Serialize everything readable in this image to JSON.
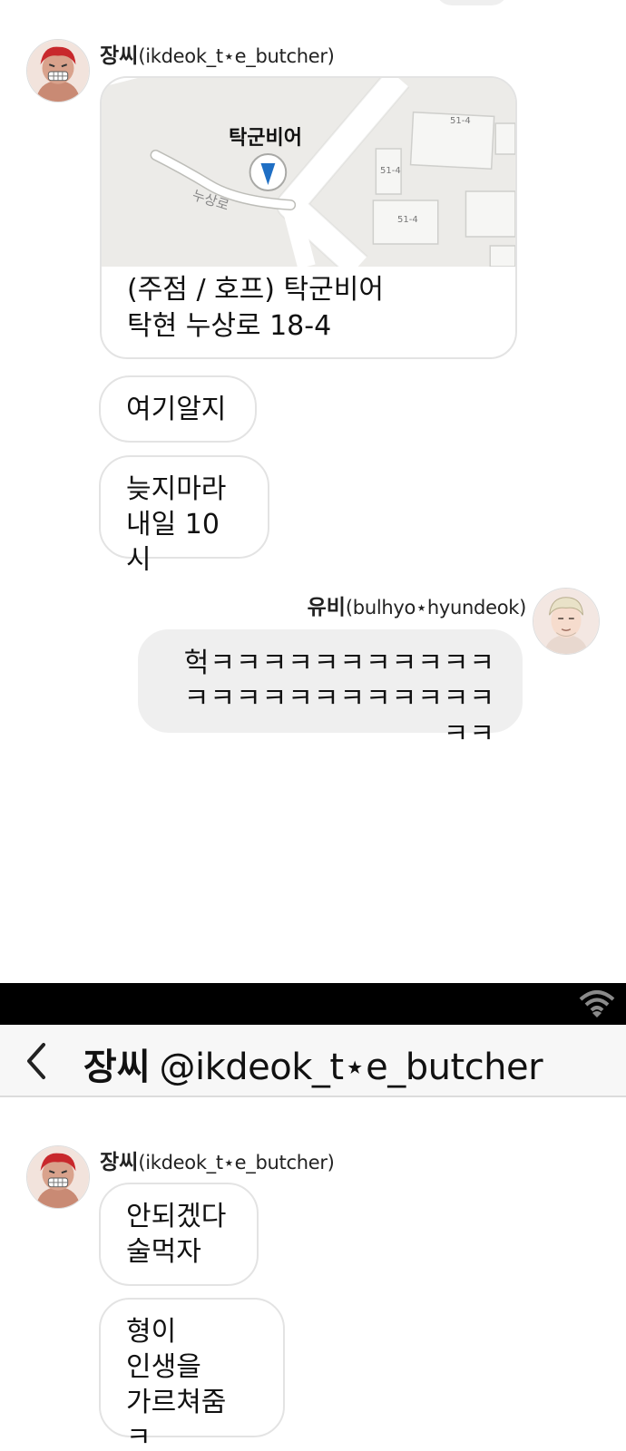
{
  "chat": {
    "contact_name": "장씨",
    "contact_handle_paren": "(ikdeok_t⋆e_butcher)",
    "me_name": "유비",
    "me_handle_paren": "(bulhyo⋆hyundeok)"
  },
  "map_card": {
    "place_label": "탁군비어",
    "street_label": "누상로",
    "lot_labels": [
      "51-4",
      "51-4",
      "51-4"
    ],
    "title": "(주점 / 호프) 탁군비어",
    "address": "탁현 누상로 18-4"
  },
  "messages_top": [
    {
      "text": "여기알지"
    },
    {
      "text": "늦지마라\n내일 10시"
    }
  ],
  "my_message": {
    "text": "헉ㅋㅋㅋㅋㅋㅋㅋㅋㅋㅋㅋ\nㅋㅋㅋㅋㅋㅋㅋㅋㅋㅋㅋㅋㅋㅋ"
  },
  "nav": {
    "title_name": "장씨",
    "title_handle": "@ikdeok_t⋆e_butcher"
  },
  "messages_bottom": [
    {
      "text": "안되겠다\n술먹자"
    },
    {
      "text": "형이\n인생을\n가르쳐줌 ㅋ"
    }
  ],
  "icons": {
    "back": "chevron-left-icon",
    "wifi": "wifi-icon",
    "map_pin": "map-pin-icon"
  },
  "colors": {
    "status_bar": "#000000",
    "nav_bar": "#f7f7f7",
    "my_bubble": "#efefef",
    "pin": "#1f6fc4"
  }
}
